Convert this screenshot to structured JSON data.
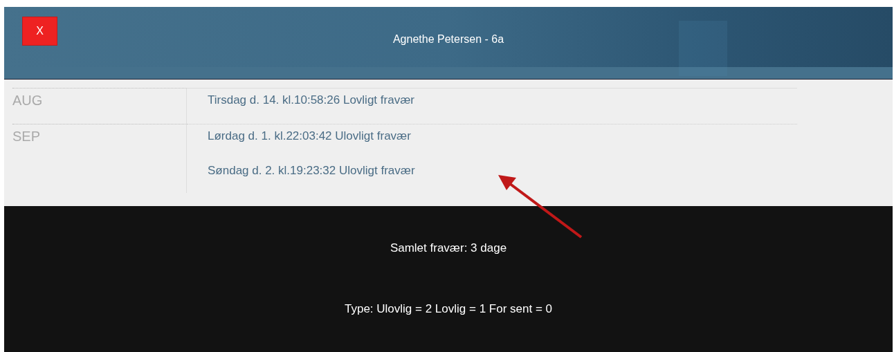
{
  "header": {
    "close_label": "X",
    "title": "Agnethe Petersen - 6a"
  },
  "months": [
    {
      "month": "AUG",
      "entries": [
        "Tirsdag d. 14. kl.10:58:26 Lovligt fravær"
      ]
    },
    {
      "month": "SEP",
      "entries": [
        "Lørdag d. 1. kl.22:03:42 Ulovligt fravær",
        "Søndag d. 2. kl.19:23:32 Ulovligt fravær"
      ]
    }
  ],
  "summary": {
    "total": "Samlet fravær: 3 dage",
    "types": "Type: Ulovlig = 2 Lovlig = 1 For sent = 0"
  }
}
